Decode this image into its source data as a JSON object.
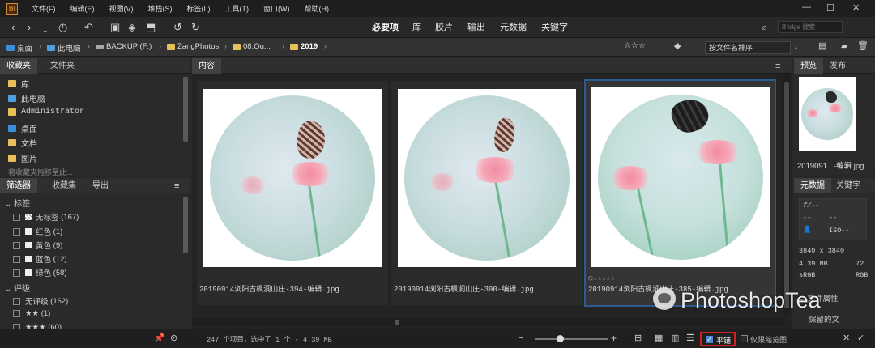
{
  "menubar": {
    "logo": "Br",
    "items": [
      "文件(F)",
      "编辑(E)",
      "视图(V)",
      "堆栈(S)",
      "标签(L)",
      "工具(T)",
      "窗口(W)",
      "帮助(H)"
    ],
    "min": "—",
    "restore": "☐",
    "close": "✕"
  },
  "toolbar": {
    "workspaces": [
      "必要项",
      "库",
      "胶片",
      "输出",
      "元数据",
      "关键字"
    ],
    "active_workspace": "必要项",
    "search_placeholder": "Bridge 搜索"
  },
  "path": {
    "crumbs": [
      "桌面",
      "此电脑",
      "BACKUP (F:)",
      "ZangPhotos",
      "08.Ou...",
      "2019"
    ],
    "sort_label": "按文件名排序"
  },
  "left_panel": {
    "tabs": [
      "收藏夹",
      "文件夹"
    ],
    "favorites": [
      "库",
      "此电脑",
      "Administrator",
      "桌面",
      "文档",
      "图片"
    ],
    "drag_hint": "将收藏夹拖移至此...",
    "filter_tabs": [
      "筛选器",
      "收藏集",
      "导出"
    ],
    "label_section": "标签",
    "labels": [
      {
        "name": "无标签",
        "count": "(167)",
        "color": "#ffffff"
      },
      {
        "name": "红色",
        "count": "(1)",
        "color": "#ffffff"
      },
      {
        "name": "黄色",
        "count": "(9)",
        "color": "#ffffff"
      },
      {
        "name": "蓝色",
        "count": "(12)",
        "color": "#ffffff"
      },
      {
        "name": "绿色",
        "count": "(58)",
        "color": "#ffffff"
      }
    ],
    "rating_section": "评级",
    "ratings": [
      {
        "name": "无评级",
        "count": "(162)"
      },
      {
        "name": "★★",
        "count": "(1)"
      },
      {
        "name": "★★★",
        "count": "(60)"
      }
    ]
  },
  "content": {
    "tab": "内容",
    "files": [
      "20190914浏阳古枫涧山庄-394-编辑.jpg",
      "20190914浏阳古枫涧山庄-390-编辑.jpg",
      "20190914浏阳古枫涧山庄-385-编辑.jpg"
    ],
    "selected_index": 2,
    "rating_stars": "☆☆☆☆☆"
  },
  "right_panel": {
    "tabs": [
      "预览",
      "发布"
    ],
    "preview_name": "2019091...-编辑.jpg",
    "meta_tabs": [
      "元数据",
      "关键字"
    ],
    "aperture": "f/--",
    "dash1": "--",
    "dash2": "--",
    "iso": "ISO--",
    "dimensions": "3840 x 3840",
    "size": "4.39 MB",
    "dpi": "72",
    "colorspace": "sRGB",
    "mode": "RGB",
    "file_props": "文件属性",
    "preserved": "保留的文"
  },
  "status": {
    "count_text": "247 个项目，选中了 1 个 - 4.39 MB",
    "tile_label": "平铺",
    "thumb_only_label": "仅限缩览图"
  },
  "watermark": {
    "text": "PhotoshopTea"
  },
  "colors": {
    "accent": "#2b5a94",
    "highlight_box": "#d42020"
  }
}
